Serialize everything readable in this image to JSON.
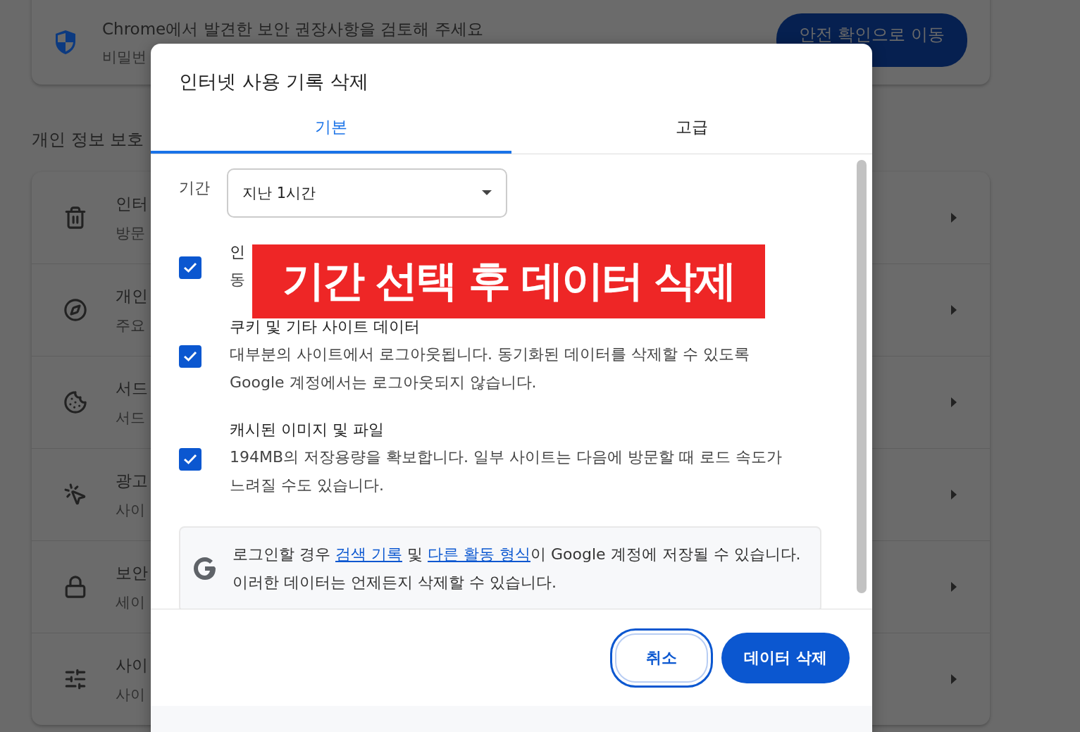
{
  "background": {
    "security_card": {
      "title": "Chrome에서 발견한 보안 권장사항을 검토해 주세요",
      "subtitle": "비밀번",
      "button": "안전 확인으로 이동"
    },
    "section_heading": "개인 정보 보호",
    "rows": [
      {
        "kind": "trash",
        "title": "인터",
        "subtitle": "방문"
      },
      {
        "kind": "compass",
        "title": "개인",
        "subtitle": "주요"
      },
      {
        "kind": "cookie",
        "title": "서드",
        "subtitle": "서드"
      },
      {
        "kind": "target",
        "title": "광고",
        "subtitle": "사이"
      },
      {
        "kind": "lock",
        "title": "보안",
        "subtitle": "세이"
      },
      {
        "kind": "sliders",
        "title": "사이",
        "subtitle": "사이"
      }
    ]
  },
  "dialog": {
    "title": "인터넷 사용 기록 삭제",
    "tabs": [
      {
        "label": "기본",
        "selected": true
      },
      {
        "label": "고급",
        "selected": false
      }
    ],
    "period": {
      "label": "기간",
      "value": "지난 1시간"
    },
    "options": [
      {
        "title": "인",
        "description": "동",
        "checked": true
      },
      {
        "title": "쿠키 및 기타 사이트 데이터",
        "description": "대부분의 사이트에서 로그아웃됩니다. 동기화된 데이터를 삭제할 수 있도록 Google 계정에서는 로그아웃되지 않습니다.",
        "checked": true
      },
      {
        "title": "캐시된 이미지 및 파일",
        "description": "194MB의 저장용량을 확보합니다. 일부 사이트는 다음에 방문할 때 로드 속도가 느려질 수도 있습니다.",
        "checked": true
      }
    ],
    "notice": [
      {
        "text": "로그인할 경우 ",
        "link": false
      },
      {
        "text": "검색 기록",
        "link": true
      },
      {
        "text": " 및 ",
        "link": false
      },
      {
        "text": "다른 활동 형식",
        "link": true
      },
      {
        "text": "이 Google 계정에 저장될 수 있습니다. 이러한 데이터는 언제든지 삭제할 수 있습니다.",
        "link": false
      }
    ],
    "buttons": [
      {
        "label": "취소",
        "kind": "secondary"
      },
      {
        "label": "데이터 삭제",
        "kind": "primary"
      }
    ]
  },
  "annotation": "기간 선택 후 데이터 삭제"
}
